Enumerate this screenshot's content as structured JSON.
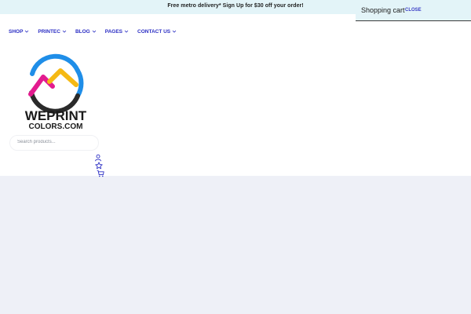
{
  "announcement": {
    "text": "Free metro delivery* Sign Up for $30 off your order!"
  },
  "cart": {
    "title": "Shopping cart",
    "close_label": "CLOSE"
  },
  "nav": {
    "items": [
      {
        "label": "SHOP"
      },
      {
        "label": "PRINTEC"
      },
      {
        "label": "BLOG"
      },
      {
        "label": "PAGES"
      },
      {
        "label": "CONTACT US"
      }
    ]
  },
  "logo": {
    "line1": "WEPRINT",
    "line2": "COLORS.COM"
  },
  "search": {
    "placeholder": "Search products...",
    "value": ""
  },
  "header_icons": {
    "account": "user-icon",
    "wishlist": "star-icon",
    "cart": "cart-icon"
  },
  "colors": {
    "accent": "#2b2ec4",
    "announce_bg": "#e3f4f8",
    "page_bg": "#eef0f7",
    "logo_blue": "#1f8ee8",
    "logo_magenta": "#e31b8f",
    "logo_yellow": "#f5b914",
    "logo_dark": "#2a2a2a"
  }
}
